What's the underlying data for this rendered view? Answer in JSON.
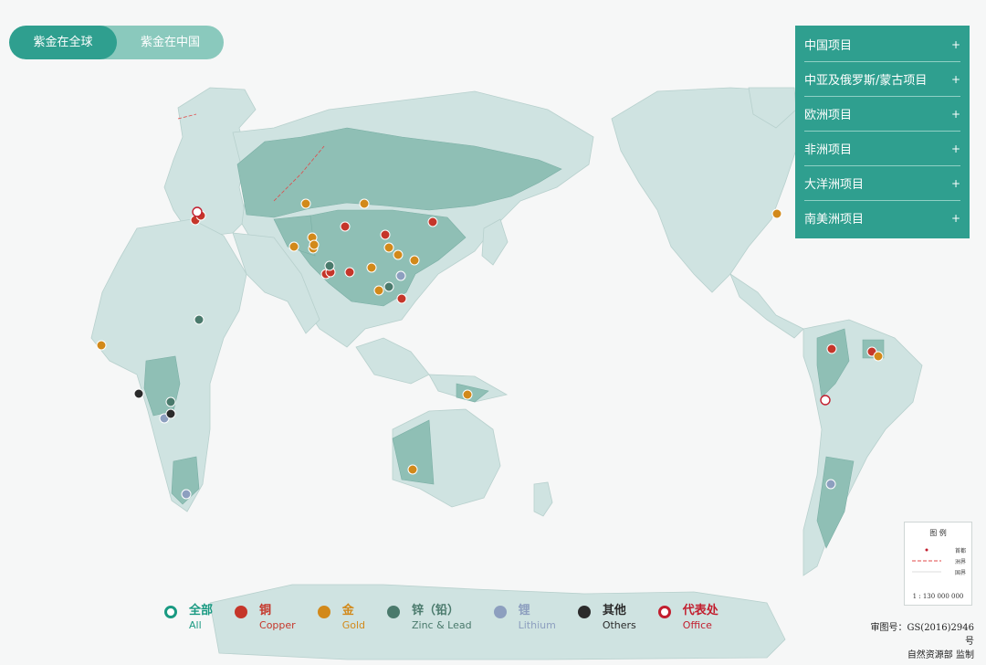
{
  "toggle": {
    "active": "紫金在全球",
    "inactive": "紫金在中国"
  },
  "panel": {
    "items": [
      "中国项目",
      "中亚及俄罗斯/蒙古项目",
      "欧洲项目",
      "非洲项目",
      "大洋洲项目",
      "南美洲项目"
    ],
    "expand_symbol": "+"
  },
  "legend": [
    {
      "zh": "全部",
      "en": "All",
      "color": "#1a9a82",
      "style": "ring"
    },
    {
      "zh": "铜",
      "en": "Copper",
      "color": "#c5362a",
      "style": "fill"
    },
    {
      "zh": "金",
      "en": "Gold",
      "color": "#d2891a",
      "style": "fill"
    },
    {
      "zh": "锌（铅）",
      "en": "Zinc & Lead",
      "color": "#4a7a6c",
      "style": "fill"
    },
    {
      "zh": "锂",
      "en": "Lithium",
      "color": "#8d9fbf",
      "style": "fill"
    },
    {
      "zh": "其他",
      "en": "Others",
      "color": "#2b2b2b",
      "style": "fill"
    },
    {
      "zh": "代表处",
      "en": "Office",
      "color": "#c21e2e",
      "style": "ring"
    }
  ],
  "map_legend": {
    "title": "图  例",
    "rows": [
      "首都",
      "洲界",
      "国界"
    ],
    "scale": "1 : 130 000 000"
  },
  "review": {
    "number": "审图号：GS(2016)2946号",
    "authority": "自然资源部 监制"
  },
  "colors": {
    "land": "#cfe3e1",
    "highlight": "#8fbfb5",
    "water": "#f6f7f7",
    "accent": "#2f9f8f"
  },
  "markers": [
    {
      "type": "copper"
    },
    {
      "type": "copper"
    },
    {
      "type": "office"
    },
    {
      "type": "copper"
    },
    {
      "type": "copper"
    },
    {
      "type": "copper"
    },
    {
      "type": "copper"
    },
    {
      "type": "copper"
    },
    {
      "type": "copper"
    },
    {
      "type": "copper"
    },
    {
      "type": "gold"
    },
    {
      "type": "gold"
    },
    {
      "type": "gold"
    },
    {
      "type": "gold"
    },
    {
      "type": "gold"
    },
    {
      "type": "gold"
    },
    {
      "type": "gold"
    },
    {
      "type": "gold"
    },
    {
      "type": "gold"
    },
    {
      "type": "gold"
    },
    {
      "type": "gold"
    },
    {
      "type": "gold"
    },
    {
      "type": "gold"
    },
    {
      "type": "gold"
    },
    {
      "type": "zinc"
    },
    {
      "type": "zinc"
    },
    {
      "type": "zinc"
    },
    {
      "type": "zinc"
    },
    {
      "type": "lithium"
    },
    {
      "type": "lithium"
    },
    {
      "type": "lithium"
    },
    {
      "type": "lithium"
    },
    {
      "type": "other"
    },
    {
      "type": "other"
    },
    {
      "type": "copper"
    },
    {
      "type": "copper"
    },
    {
      "type": "office"
    },
    {
      "type": "gold"
    },
    {
      "type": "gold"
    }
  ]
}
